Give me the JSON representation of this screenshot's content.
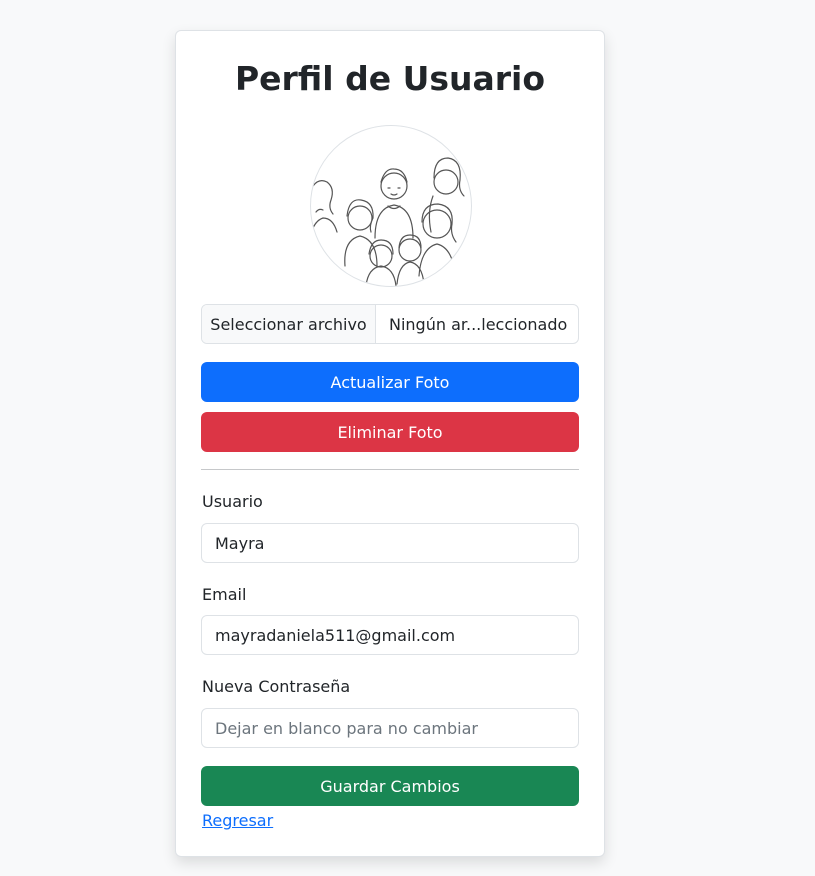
{
  "page": {
    "title": "Perfil de Usuario"
  },
  "photo": {
    "avatar_alt": "Ilustración de un grupo de personas",
    "file_button_label": "Seleccionar archivo",
    "file_name": "Ningún ar...leccionado",
    "update_label": "Actualizar Foto",
    "delete_label": "Eliminar Foto"
  },
  "form": {
    "username_label": "Usuario",
    "username_value": "Mayra",
    "email_label": "Email",
    "email_value": "mayradaniela511@gmail.com",
    "password_label": "Nueva Contraseña",
    "password_placeholder": "Dejar en blanco para no cambiar",
    "save_label": "Guardar Cambios",
    "back_label": "Regresar"
  },
  "colors": {
    "primary": "#0d6efd",
    "danger": "#dc3545",
    "success": "#198754",
    "background": "#f8f9fa"
  }
}
